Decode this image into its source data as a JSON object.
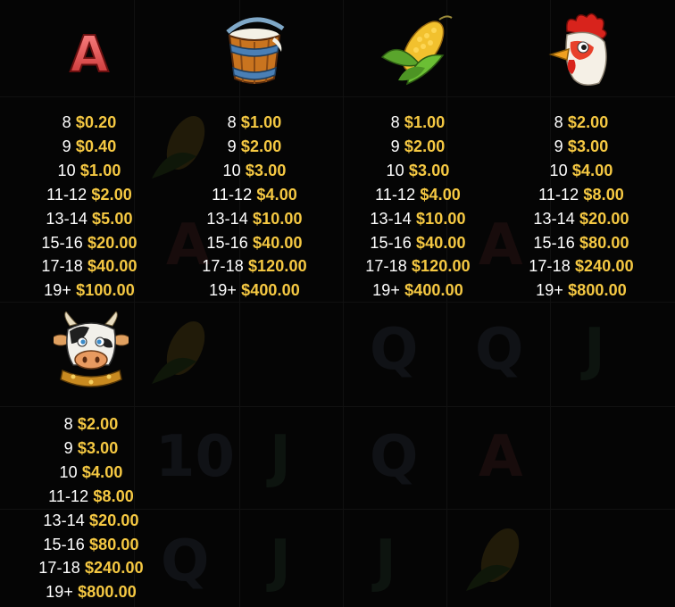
{
  "paytable": [
    {
      "symbol_icon": "letter-a-icon",
      "symbol_text": "A",
      "rows": [
        {
          "count": "8",
          "payout": "$0.20"
        },
        {
          "count": "9",
          "payout": "$0.40"
        },
        {
          "count": "10",
          "payout": "$1.00"
        },
        {
          "count": "11-12",
          "payout": "$2.00"
        },
        {
          "count": "13-14",
          "payout": "$5.00"
        },
        {
          "count": "15-16",
          "payout": "$20.00"
        },
        {
          "count": "17-18",
          "payout": "$40.00"
        },
        {
          "count": "19+",
          "payout": "$100.00"
        }
      ]
    },
    {
      "symbol_icon": "milk-bucket-icon",
      "rows": [
        {
          "count": "8",
          "payout": "$1.00"
        },
        {
          "count": "9",
          "payout": "$2.00"
        },
        {
          "count": "10",
          "payout": "$3.00"
        },
        {
          "count": "11-12",
          "payout": "$4.00"
        },
        {
          "count": "13-14",
          "payout": "$10.00"
        },
        {
          "count": "15-16",
          "payout": "$40.00"
        },
        {
          "count": "17-18",
          "payout": "$120.00"
        },
        {
          "count": "19+",
          "payout": "$400.00"
        }
      ]
    },
    {
      "symbol_icon": "corn-icon",
      "rows": [
        {
          "count": "8",
          "payout": "$1.00"
        },
        {
          "count": "9",
          "payout": "$2.00"
        },
        {
          "count": "10",
          "payout": "$3.00"
        },
        {
          "count": "11-12",
          "payout": "$4.00"
        },
        {
          "count": "13-14",
          "payout": "$10.00"
        },
        {
          "count": "15-16",
          "payout": "$40.00"
        },
        {
          "count": "17-18",
          "payout": "$120.00"
        },
        {
          "count": "19+",
          "payout": "$400.00"
        }
      ]
    },
    {
      "symbol_icon": "rooster-icon",
      "rows": [
        {
          "count": "8",
          "payout": "$2.00"
        },
        {
          "count": "9",
          "payout": "$3.00"
        },
        {
          "count": "10",
          "payout": "$4.00"
        },
        {
          "count": "11-12",
          "payout": "$8.00"
        },
        {
          "count": "13-14",
          "payout": "$20.00"
        },
        {
          "count": "15-16",
          "payout": "$80.00"
        },
        {
          "count": "17-18",
          "payout": "$240.00"
        },
        {
          "count": "19+",
          "payout": "$800.00"
        }
      ]
    },
    {
      "symbol_icon": "cow-icon",
      "rows": [
        {
          "count": "8",
          "payout": "$2.00"
        },
        {
          "count": "9",
          "payout": "$3.00"
        },
        {
          "count": "10",
          "payout": "$4.00"
        },
        {
          "count": "11-12",
          "payout": "$8.00"
        },
        {
          "count": "13-14",
          "payout": "$20.00"
        },
        {
          "count": "15-16",
          "payout": "$80.00"
        },
        {
          "count": "17-18",
          "payout": "$240.00"
        },
        {
          "count": "19+",
          "payout": "$800.00"
        }
      ]
    }
  ],
  "colors": {
    "count_text": "#ffffff",
    "payout_text": "#f5c842",
    "background": "#050505"
  },
  "background_symbols": [
    {
      "text": "A"
    },
    {
      "text": "A"
    },
    {
      "text": "Q"
    },
    {
      "text": "Q"
    },
    {
      "text": "J"
    },
    {
      "text": "10"
    },
    {
      "text": "J"
    },
    {
      "text": "Q"
    },
    {
      "text": "A"
    },
    {
      "text": "Q"
    },
    {
      "text": "J"
    },
    {
      "text": "J"
    }
  ]
}
